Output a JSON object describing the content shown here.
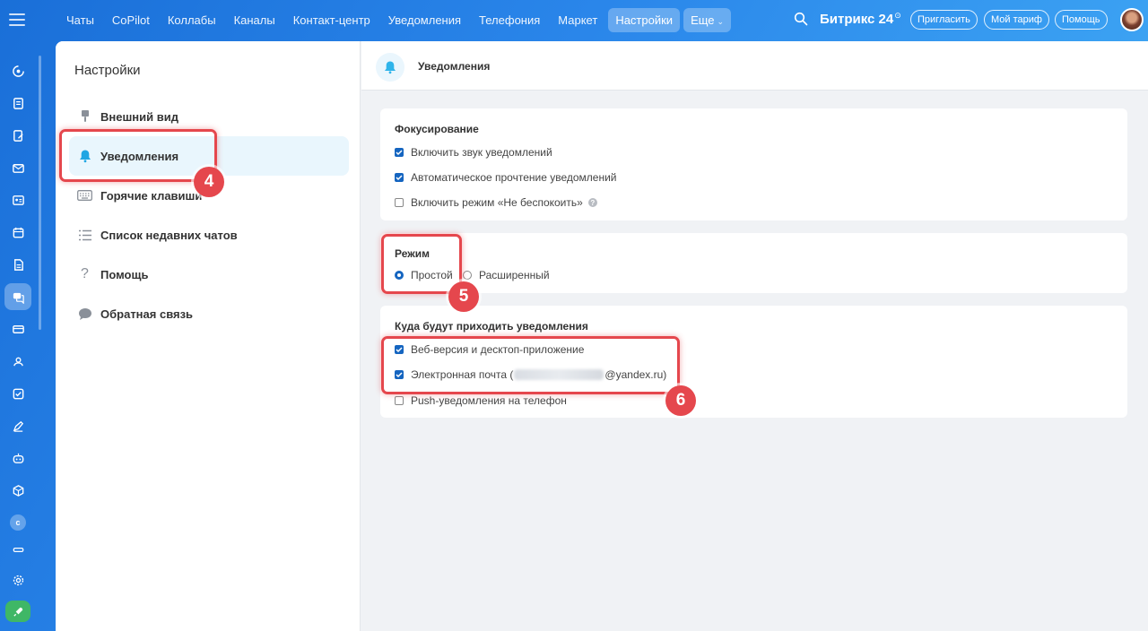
{
  "topbar": {
    "nav": [
      {
        "label": "Чаты",
        "name": "nav-chats"
      },
      {
        "label": "CoPilot",
        "name": "nav-copilot"
      },
      {
        "label": "Коллабы",
        "name": "nav-collabs"
      },
      {
        "label": "Каналы",
        "name": "nav-channels"
      },
      {
        "label": "Контакт-центр",
        "name": "nav-contact-center"
      },
      {
        "label": "Уведомления",
        "name": "nav-notifications"
      },
      {
        "label": "Телефония",
        "name": "nav-telephony"
      },
      {
        "label": "Маркет",
        "name": "nav-market"
      },
      {
        "label": "Настройки",
        "name": "nav-settings",
        "active": true
      },
      {
        "label": "Еще",
        "name": "nav-more",
        "dropdown": true
      }
    ],
    "brand": "Битрикс 24",
    "brand_mark": "⊙",
    "invite_label": "Пригласить",
    "tariff_label": "Мой тариф",
    "help_label": "Помощь"
  },
  "rail_icons": [
    "copilot-icon",
    "feed-icon",
    "tasks-edit-icon",
    "mail-icon",
    "contacts-card-icon",
    "calendar-icon",
    "document-icon",
    "chat-icon",
    "terminal-icon",
    "groups-icon",
    "checkbox-icon",
    "sign-icon",
    "robot-icon",
    "box-icon",
    "company-c-icon",
    "collapse-icon",
    "gear-icon",
    "rocket-icon"
  ],
  "rail_c_letter": "c",
  "sidebar": {
    "title": "Настройки",
    "items": [
      {
        "label": "Внешний вид",
        "icon": "brush-icon"
      },
      {
        "label": "Уведомления",
        "icon": "bell-icon",
        "active": true
      },
      {
        "label": "Горячие клавиши",
        "icon": "keyboard-icon"
      },
      {
        "label": "Список недавних чатов",
        "icon": "list-icon"
      },
      {
        "label": "Помощь",
        "icon": "question-icon"
      },
      {
        "label": "Обратная связь",
        "icon": "speech-bubble-icon"
      }
    ]
  },
  "header": {
    "title": "Уведомления",
    "icon": "bell-icon"
  },
  "focus": {
    "title": "Фокусирование",
    "options": [
      {
        "label": "Включить звук уведомлений",
        "checked": true
      },
      {
        "label": "Автоматическое прочтение уведомлений",
        "checked": true
      },
      {
        "label": "Включить режим «Не беспокоить»",
        "checked": false,
        "help": "?"
      }
    ]
  },
  "mode": {
    "title": "Режим",
    "options": [
      {
        "label": "Простой",
        "selected": true
      },
      {
        "label": "Расширенный",
        "selected": false
      }
    ]
  },
  "delivery": {
    "title": "Куда будут приходить уведомления",
    "options": [
      {
        "label": "Веб-версия и десктоп-приложение",
        "checked": true
      },
      {
        "label_prefix": "Электронная почта (",
        "label_suffix": "@yandex.ru)",
        "checked": true
      },
      {
        "label": "Push-уведомления на телефон",
        "checked": false
      }
    ]
  },
  "annotations": {
    "badge_4": "4",
    "badge_5": "5",
    "badge_6": "6"
  },
  "colors": {
    "accent": "#1565c0",
    "highlight": "#e5474d",
    "active_bg": "#e9f6fd",
    "topbar": "#2a86ea"
  }
}
